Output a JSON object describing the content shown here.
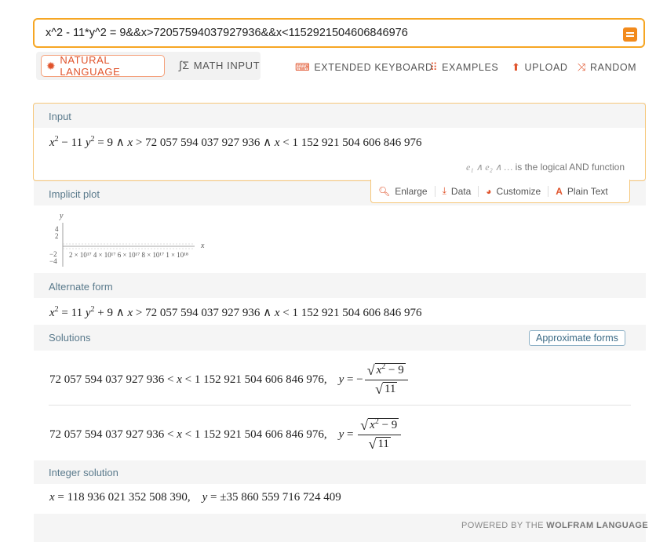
{
  "search": {
    "value": "x^2 - 11*y^2 = 9&&x>72057594037927936&&x<1152921504606846976",
    "go_icon": "equals-icon"
  },
  "modes": {
    "natural": "NATURAL LANGUAGE",
    "math": "MATH INPUT"
  },
  "toolbar": {
    "keyboard": "EXTENDED KEYBOARD",
    "examples": "EXAMPLES",
    "upload": "UPLOAD",
    "random": "RANDOM"
  },
  "pods": {
    "input": {
      "title": "Input",
      "lhs_x_exp": "2",
      "lhs_y_exp": "2",
      "expr_parts": [
        "x",
        " − 11 ",
        "y",
        " = 9 ∧ ",
        "x",
        " > 72 057 594 037 927 936 ∧ ",
        "x",
        " < 1 152 921 504 606 846 976"
      ],
      "note": "is the logical AND function",
      "note_math": "e₁ ∧ e₂ ∧ …"
    },
    "actions": {
      "enlarge": "Enlarge",
      "data": "Data",
      "customize": "Customize",
      "plain": "Plain Text"
    },
    "plot": {
      "title": "Implicit plot",
      "y_label": "y",
      "x_label": "x",
      "y_ticks": [
        "4",
        "2",
        "−2",
        "−4"
      ],
      "x_ticks": "2 × 10¹⁷ 4 × 10¹⁷ 6 × 10¹⁷ 8 × 10¹⁷ 1 × 10¹⁸"
    },
    "alternate": {
      "title": "Alternate form",
      "text_a": " = 11 ",
      "text_b": " + 9 ∧ ",
      "text_c": " > 72 057 594 037 927 936 ∧ ",
      "text_d": " < 1 152 921 504 606 846 976"
    },
    "solutions": {
      "title": "Solutions",
      "approx_button": "Approximate forms",
      "lower": "72 057 594 037 927 936",
      "upper": "1 152 921 504 606 846 976",
      "sign1": "−",
      "sign2": "",
      "num_text": "x",
      "num_rest": " − 9",
      "den_text": "11"
    },
    "integer": {
      "title": "Integer solution",
      "x_value": "118 936 021 352 508 390",
      "y_value": "±35 860 559 716 724 409"
    }
  },
  "footer": {
    "text": "POWERED BY THE",
    "brand": "WOLFRAM LANGUAGE"
  },
  "colors": {
    "accent": "#e0532b",
    "border": "#f6a623",
    "pod_title": "#5a7a8c"
  }
}
